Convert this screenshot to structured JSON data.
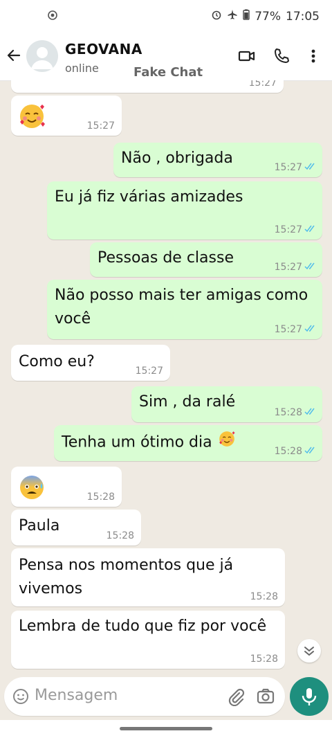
{
  "status_bar": {
    "battery": "77%",
    "time": "17:05"
  },
  "header": {
    "contact_name": "GEOVANA",
    "status": "online",
    "watermark": "Fake Chat"
  },
  "messages": [
    {
      "dir": "in",
      "text": "",
      "emoji": "smiling-face-with-hearts",
      "time": "15:27"
    },
    {
      "dir": "out",
      "text": "Não , obrigada",
      "time": "15:27"
    },
    {
      "dir": "out",
      "text": "Eu já fiz várias amizades",
      "time": "15:27"
    },
    {
      "dir": "out",
      "text": "Pessoas de classe",
      "time": "15:27"
    },
    {
      "dir": "out",
      "text": "Não posso mais ter amigas como",
      "text2": "você",
      "time": "15:27"
    },
    {
      "dir": "in",
      "text": "Como eu?",
      "time": "15:27"
    },
    {
      "dir": "out",
      "text": "Sim , da ralé",
      "time": "15:28"
    },
    {
      "dir": "out",
      "text": "Tenha um ótimo dia",
      "emoji": "smiling-face-with-hearts",
      "time": "15:28"
    },
    {
      "dir": "in",
      "text": "",
      "emoji": "anxious-face-with-sweat",
      "time": "15:28"
    },
    {
      "dir": "in",
      "text": "Paula",
      "time": "15:28"
    },
    {
      "dir": "in",
      "text": "Pensa nos momentos que já",
      "text2": "vivemos",
      "time": "15:28"
    },
    {
      "dir": "in",
      "text": "Lembra de tudo que fiz por você",
      "time": "15:28"
    }
  ],
  "partial_top_time": "15:27",
  "composer": {
    "placeholder": "Mensagem"
  },
  "colors": {
    "accent": "#1e8f7e",
    "out_bubble": "#d9fdd3",
    "in_bubble": "#ffffff",
    "tick": "#53bdeb",
    "wallpaper": "#efeae2"
  }
}
